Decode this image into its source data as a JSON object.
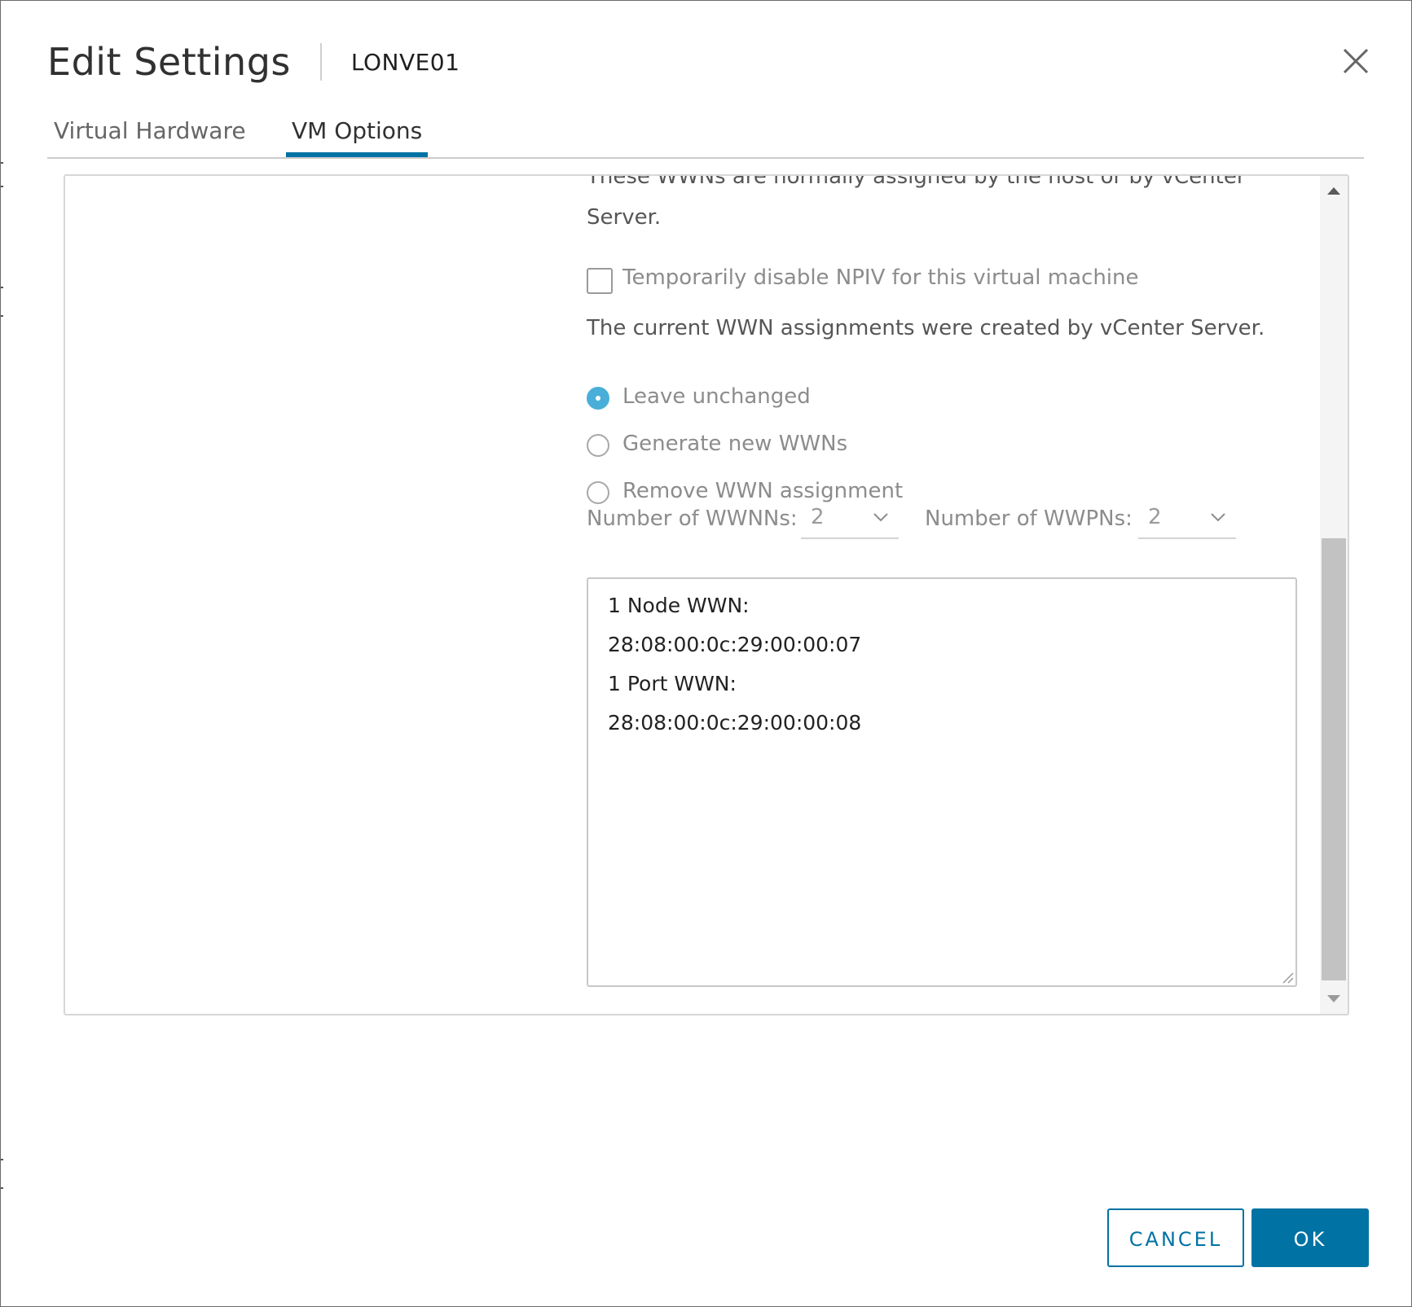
{
  "dialog": {
    "title": "Edit Settings",
    "subtitle": "LONVE01",
    "close_icon": "close-icon"
  },
  "tabs": [
    {
      "label": "Virtual Hardware",
      "active": false
    },
    {
      "label": "VM Options",
      "active": true
    }
  ],
  "npiv": {
    "partial_line": "These WWNs are normally assigned by the host or by vCenter",
    "server_line": "Server.",
    "disable_checkbox_label": "Temporarily disable NPIV for this virtual machine",
    "disable_checked": false,
    "current_assignment_text": "The current WWN assignments were created by vCenter Server.",
    "options": [
      {
        "label": "Leave unchanged",
        "selected": true
      },
      {
        "label": "Generate new WWNs",
        "selected": false
      },
      {
        "label": "Remove WWN assignment",
        "selected": false
      }
    ],
    "wwnn_label": "Number of WWNNs:",
    "wwnn_value": "2",
    "wwpn_label": "Number of WWPNs:",
    "wwpn_value": "2",
    "wwn_text_lines": [
      "1 Node WWN:",
      "28:08:00:0c:29:00:00:07",
      "1 Port WWN:",
      "28:08:00:0c:29:00:00:08"
    ]
  },
  "footer": {
    "cancel_label": "CANCEL",
    "ok_label": "OK"
  },
  "colors": {
    "accent": "#0072a3",
    "radio_selected": "#49afd9"
  }
}
